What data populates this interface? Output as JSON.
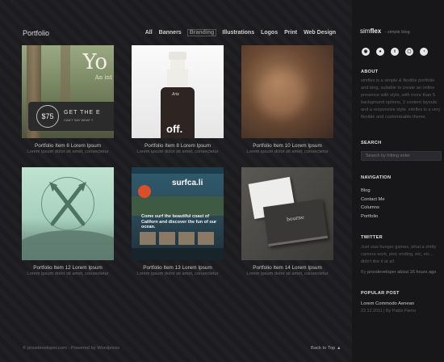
{
  "header": {
    "section_title": "Portfolio",
    "filters": [
      "All",
      "Banners",
      "Branding",
      "Illustrations",
      "Logos",
      "Print",
      "Web Design"
    ],
    "active_filter": "Branding"
  },
  "portfolio": [
    {
      "title": "Portfolio Item 6 Lorem Ipsum",
      "excerpt": "Lorem ipsum dolor sit amet, consectetur"
    },
    {
      "title": "Portfolio Item 8 Lorem Ipsum",
      "excerpt": "Lorem ipsum dolor sit amet, consectetur"
    },
    {
      "title": "Portfolio Item 10 Lorem Ipsum",
      "excerpt": "Lorem ipsum dolor sit amet, consectetur"
    },
    {
      "title": "Portfolio Item 12 Lorem Ipsum",
      "excerpt": "Lorem ipsum dolor sit amet, consectetur"
    },
    {
      "title": "Portfolio Item 13 Lorem Ipsum",
      "excerpt": "Lorem ipsum dolor sit amet, consectetur"
    },
    {
      "title": "Portfolio Item 14 Lorem Ipsum",
      "excerpt": "Lorem ipsum dolor sit amet, consectetur"
    }
  ],
  "thumb_text": {
    "t1_big": "Yo",
    "t1_sub": "An int",
    "t1_price": "$75",
    "t1_get": "GET THE E",
    "t1_small": "CAN'T SAY WHAT T",
    "t2_brand": "Arte",
    "t2_off": "off.",
    "t4_none": "",
    "t5_logo": "surfca.li",
    "t5_head": "Come surf the beautiful coast of Californ and discover the fun of our ocean.",
    "t6_card": "bourne"
  },
  "sidebar": {
    "brand_name_light": "sim",
    "brand_name_bold": "flex",
    "brand_tagline": "- simple blog",
    "social_icons": [
      "dribbble-icon",
      "github-icon",
      "twitter-icon",
      "instagram-icon",
      "rss-icon"
    ],
    "about": {
      "heading": "ABOUT",
      "text": "simflex is a simple & flexible portfolio and blog, suitable to create an online presence with style, with more than 5 background options, 2 content layouts and a responsive style. simflex is a very flexible and customizable theme."
    },
    "search": {
      "heading": "SEARCH",
      "placeholder": "Search by hitting enter"
    },
    "navigation": {
      "heading": "NAVIGATION",
      "items": [
        "Blog",
        "Contact Me",
        "Columns",
        "Portfolio"
      ]
    },
    "twitter": {
      "heading": "TWITTER",
      "text": "Just saw hunger games, what a shitty camera work, plot, ending, etc, etc... didn't like it at all",
      "by": "By ",
      "user": "proxdeveloper",
      "time": " about 16 hours ago"
    },
    "popular": {
      "heading": "POPULAR POST",
      "title": "Lorem Commodo Aenean",
      "meta": "22.12.2011 | By Pablo Fierro"
    }
  },
  "footer": {
    "left": "© proxdeveloper.com - Powered by Wordpress",
    "right": "Back to Top"
  }
}
